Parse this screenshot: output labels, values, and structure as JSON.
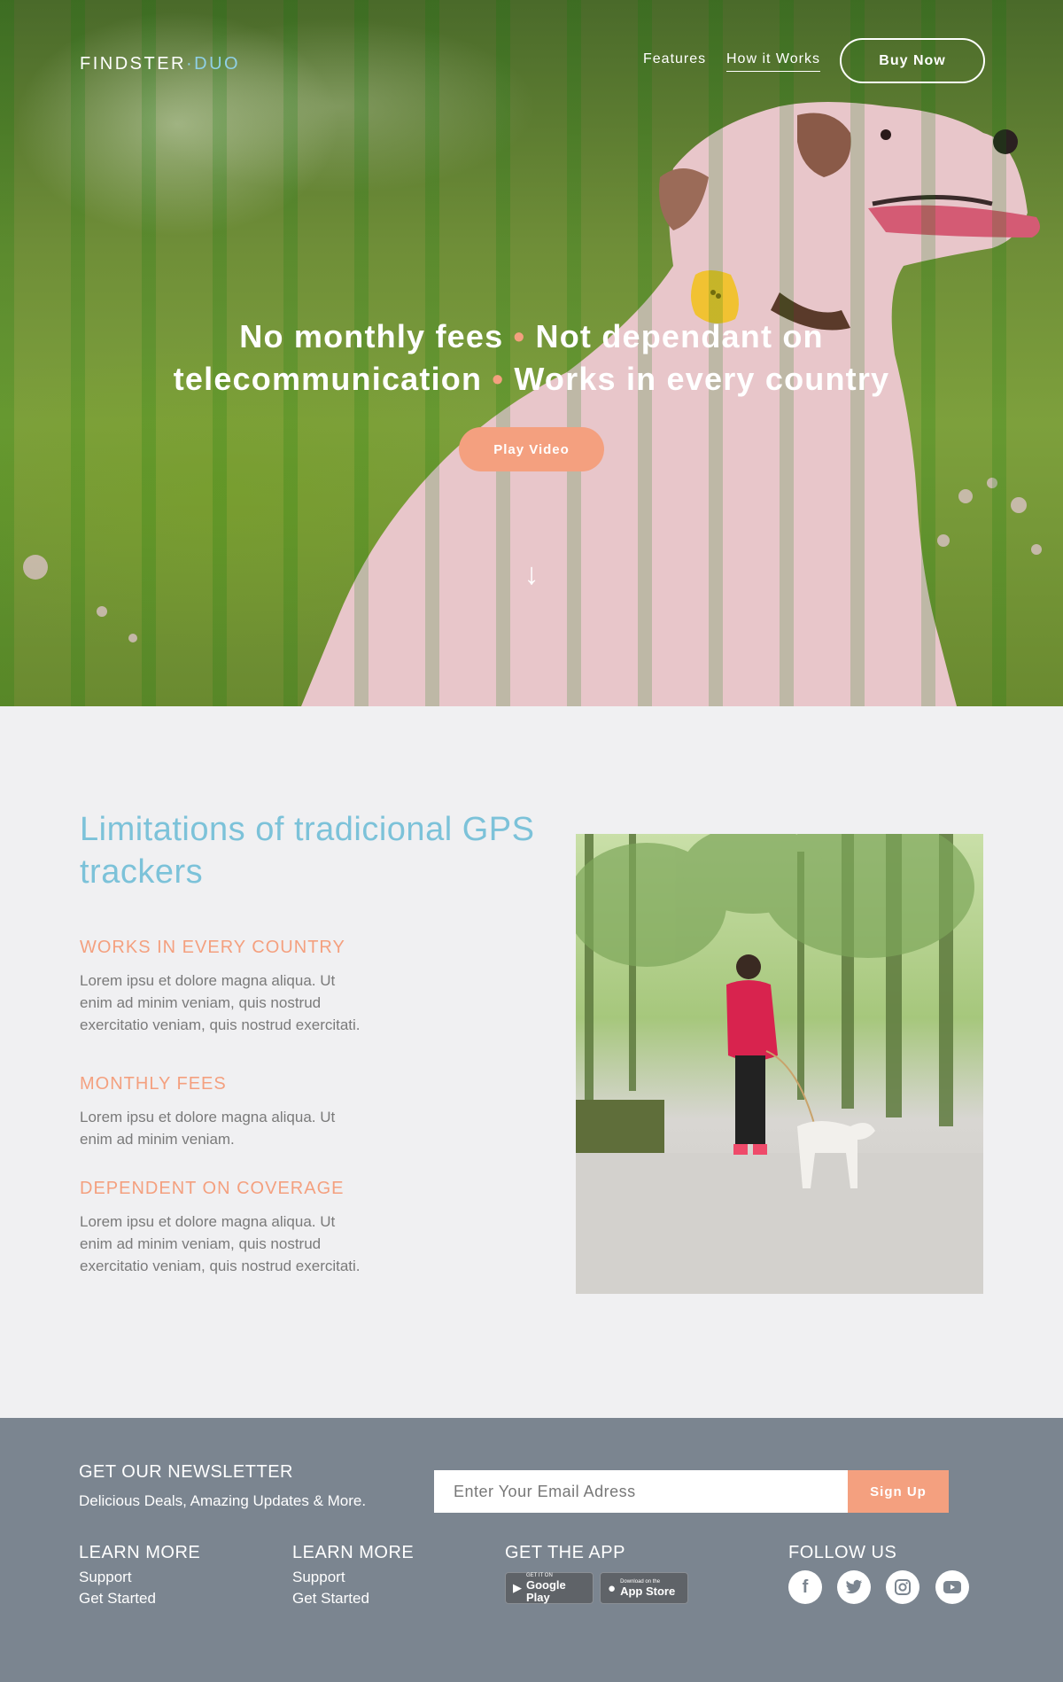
{
  "brand": {
    "name_part1": "FINDSTER",
    "separator": "·",
    "name_part2": "DUO"
  },
  "nav": {
    "features": "Features",
    "how_it_works": "How it Works",
    "buy_now": "Buy Now"
  },
  "hero": {
    "line1_a": "No monthly fees",
    "bullet": "•",
    "line1_b": "Not dependant on",
    "line2_a": "telecommunication",
    "line2_b": "Works in every country",
    "play_video": "Play Video",
    "scroll_arrow": "↓"
  },
  "features": {
    "title": "Limitations of tradicional GPS trackers",
    "items": [
      {
        "heading": "WORKS IN EVERY COUNTRY",
        "text": "Lorem ipsu et dolore magna aliqua. Ut enim ad minim veniam, quis nostrud exercitatio veniam, quis nostrud exercitati."
      },
      {
        "heading": "MONTHLY FEES",
        "text": "Lorem ipsu et dolore magna aliqua. Ut enim ad minim veniam."
      },
      {
        "heading": "DEPENDENT ON COVERAGE",
        "text": "Lorem ipsu et dolore magna aliqua. Ut enim ad minim veniam, quis nostrud exercitatio veniam, quis nostrud exercitati."
      }
    ]
  },
  "footer": {
    "newsletter_heading": "GET OUR NEWSLETTER",
    "newsletter_sub": "Delicious Deals, Amazing Updates & More.",
    "email_placeholder": "Enter Your Email Adress",
    "signup": "Sign Up",
    "learn_more_1": {
      "heading": "LEARN MORE",
      "links": [
        "Support",
        "Get Started"
      ]
    },
    "learn_more_2": {
      "heading": "LEARN MORE",
      "links": [
        "Support",
        "Get Started"
      ]
    },
    "get_app": {
      "heading": "GET THE APP",
      "google": {
        "small": "GET IT ON",
        "big": "Google Play"
      },
      "apple": {
        "small": "Download on the",
        "big": "App Store"
      }
    },
    "follow": {
      "heading": "FOLLOW US",
      "icons": [
        "facebook-icon",
        "twitter-icon",
        "instagram-icon",
        "youtube-icon"
      ]
    }
  },
  "colors": {
    "accent_orange": "#f4a07f",
    "accent_blue": "#7cc2d9",
    "footer_bg": "#7b8590",
    "page_bg": "#f0f0f2"
  }
}
